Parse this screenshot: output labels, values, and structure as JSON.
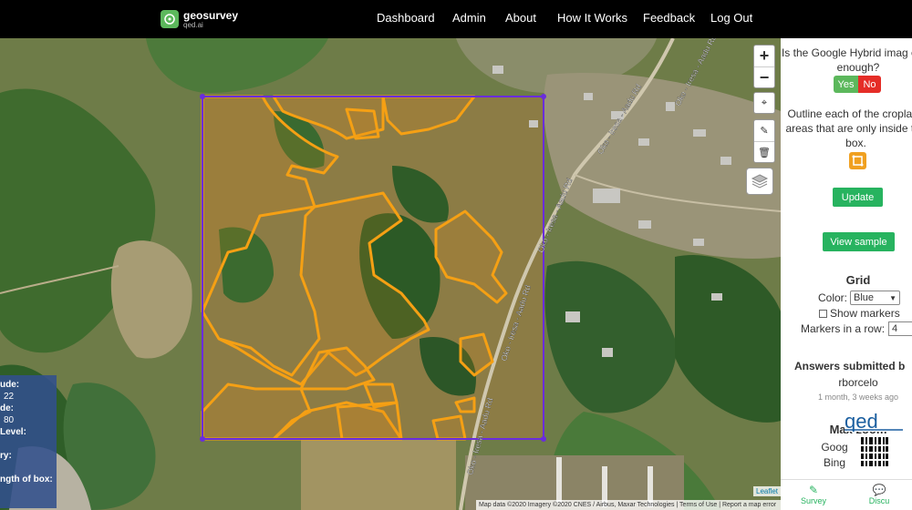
{
  "brand": {
    "name": "geosurvey",
    "sub": "qed.ai"
  },
  "nav": {
    "dashboard": "Dashboard",
    "admin": "Admin",
    "about": "About",
    "how_it_works": "How It Works",
    "feedback": "Feedback",
    "logout": "Log Out"
  },
  "map": {
    "zoom_in": "+",
    "zoom_out": "−",
    "road_labels": [
      "Oko - Iresa - Aadu Rd",
      "Oko - Iresa - Aadu Rd",
      "Oko - Iresa - Aadu Rd",
      "Oko - Iresa - Aadu Rd",
      "Oko - Iresa - Aadu Rd",
      "Oko -"
    ],
    "info_panel": [
      "ude:",
      "22",
      "de:",
      "80",
      "Level:",
      "",
      "ry:",
      "",
      "ngth of box:"
    ],
    "attribution": "Map data ©2020 Imagery ©2020 CNES / Airbus, Maxar Technologies  |  Terms of Use  |  Report a map error",
    "leaflet": "Leaflet"
  },
  "sidebar": {
    "question": "Is the Google Hybrid imag clear enough?",
    "yes": "Yes",
    "no": "No",
    "instruction": "Outline each of the cropland areas that are only inside the box.",
    "update": "Update",
    "view_sample": "View sample",
    "grid_title": "Grid",
    "color_label": "Color:",
    "color_value": "Blue",
    "show_markers": "Show markers",
    "markers_label": "Markers in a row:",
    "markers_value": "4",
    "answers_title": "Answers submitted b",
    "user": "rborcelo",
    "time_ago": "1 month, 3 weeks ago",
    "max_zoom": "Max zoom",
    "google": "Goog",
    "bing": "Bing",
    "qed_logo": "qed",
    "tab_survey": "Survey",
    "tab_discuss": "Discu"
  },
  "colors": {
    "accent": "#27b35f",
    "cropland_outline": "#f5a014",
    "box_outline": "#6a2ddc",
    "no_button": "#e52d27"
  }
}
